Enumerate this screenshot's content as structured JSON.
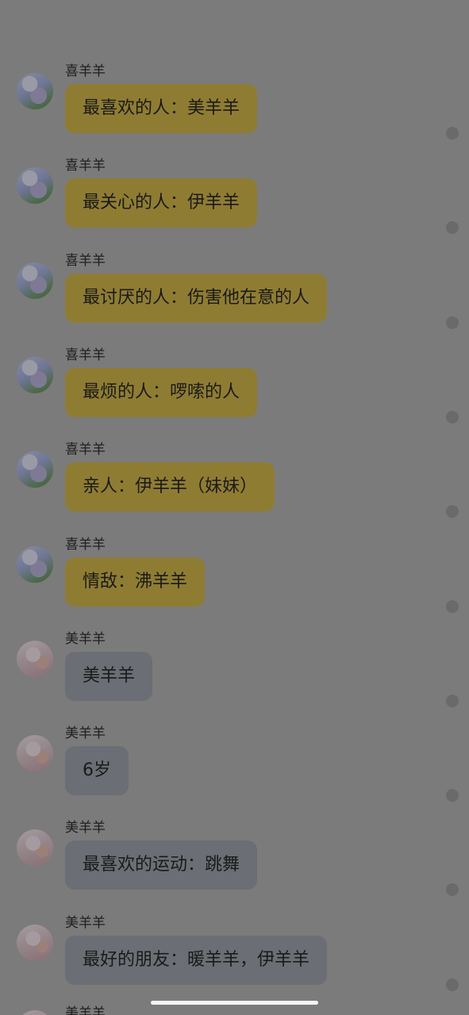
{
  "messages": [
    {
      "sender": "喜羊羊",
      "avatar": "xi-yang-yang-avatar",
      "text": "最喜欢的人：美羊羊",
      "bubble_color": "#8f7c33"
    },
    {
      "sender": "喜羊羊",
      "avatar": "xi-yang-yang-avatar",
      "text": "最关心的人：伊羊羊",
      "bubble_color": "#8f7c33"
    },
    {
      "sender": "喜羊羊",
      "avatar": "xi-yang-yang-avatar",
      "text": "最讨厌的人：伤害他在意的人",
      "bubble_color": "#8f7c33"
    },
    {
      "sender": "喜羊羊",
      "avatar": "xi-yang-yang-avatar",
      "text": "最烦的人：啰嗦的人",
      "bubble_color": "#8f7c33"
    },
    {
      "sender": "喜羊羊",
      "avatar": "xi-yang-yang-avatar",
      "text": "亲人：伊羊羊（妹妹）",
      "bubble_color": "#8f7c33"
    },
    {
      "sender": "喜羊羊",
      "avatar": "xi-yang-yang-avatar",
      "text": "情敌：沸羊羊",
      "bubble_color": "#8f7c33"
    },
    {
      "sender": "美羊羊",
      "avatar": "mei-yang-yang-avatar",
      "text": "美羊羊",
      "bubble_color": "#6b6e74"
    },
    {
      "sender": "美羊羊",
      "avatar": "mei-yang-yang-avatar",
      "text": "6岁",
      "bubble_color": "#6b6e74"
    },
    {
      "sender": "美羊羊",
      "avatar": "mei-yang-yang-avatar",
      "text": "最喜欢的运动：跳舞",
      "bubble_color": "#6b6e74"
    },
    {
      "sender": "美羊羊",
      "avatar": "mei-yang-yang-avatar",
      "text": "最好的朋友：暖羊羊，伊羊羊",
      "bubble_color": "#6b6e74"
    }
  ],
  "partial_message": {
    "sender": "美羊羊"
  }
}
